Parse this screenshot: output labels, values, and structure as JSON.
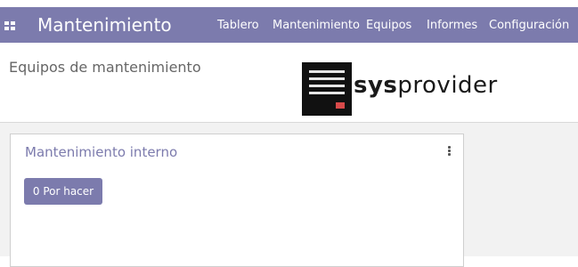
{
  "navbar": {
    "app_title": "Mantenimiento",
    "apps_icon": "grid-apps-icon",
    "menu": [
      "Tablero",
      "Mantenimiento",
      "Equipos",
      "Informes",
      "Configuración"
    ]
  },
  "breadcrumb": "Equipos de mantenimiento",
  "logo": {
    "bold": "sys",
    "rest": "provider"
  },
  "card": {
    "title": "Mantenimiento interno",
    "menu_icon": "vertical-ellipsis-icon",
    "todo_button": "0 Por hacer"
  },
  "colors": {
    "primary": "#7c7bad",
    "navbar_text": "#ffffff",
    "logo_red": "#d84a4a"
  }
}
